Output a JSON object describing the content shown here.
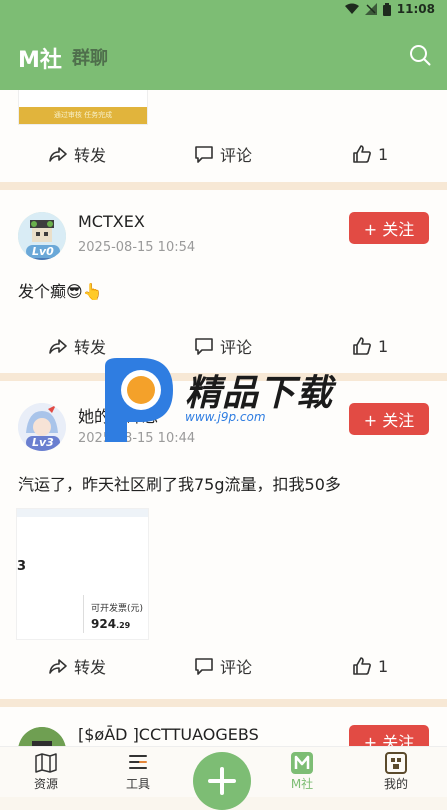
{
  "status": {
    "time": "11:08"
  },
  "header": {
    "title": "M社",
    "subtitle": "群聊"
  },
  "actions": {
    "forward": "转发",
    "comment": "评论"
  },
  "posts": [
    {
      "likes": "1",
      "banner_text": "通过审核 任务完成"
    },
    {
      "user": "MCTXEX",
      "level": "Lv0",
      "time": "2025-08-15 10:54",
      "follow": "+ 关注",
      "text": "发个癫😎👆",
      "likes": "1"
    },
    {
      "user": "她的碎碎念",
      "level": "Lv3",
      "time": "2025-08-15 10:44",
      "follow": "+ 关注",
      "text": "汽运了，昨天社区刷了我75g流量，扣我50多",
      "likes": "1",
      "image": {
        "digit": "3",
        "label": "可开发票(元)",
        "amount": "924",
        "amount_dec": ".29"
      }
    },
    {
      "user": "[$øĀD ]CCTTUAOGEBS",
      "follow": "+ 关注"
    }
  ],
  "watermark": {
    "brand": "精品下载",
    "url": "www.j9p.com"
  },
  "tabs": {
    "resources": "资源",
    "tools": "工具",
    "msocial": "M社",
    "mine": "我的"
  },
  "colors": {
    "primary": "#7dbd74",
    "follow": "#e24b44",
    "separator": "#f7e8d5"
  }
}
